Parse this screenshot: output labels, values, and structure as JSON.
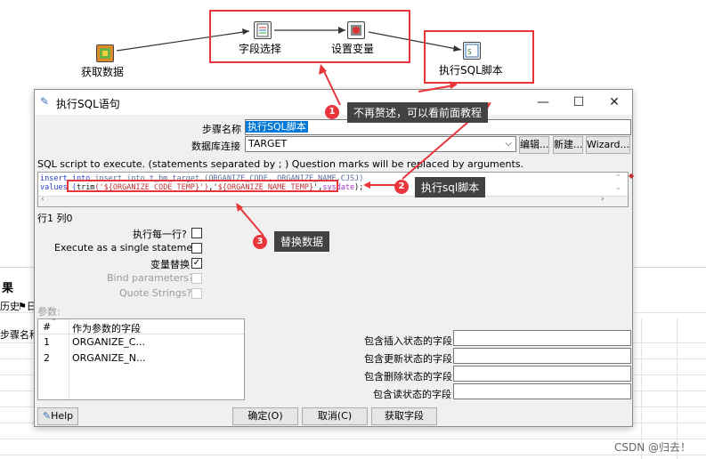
{
  "flow": {
    "nodes": [
      {
        "label": "获取数据"
      },
      {
        "label": "字段选择"
      },
      {
        "label": "设置变量"
      },
      {
        "label": "执行SQL脚本"
      }
    ]
  },
  "background": {
    "panel_title": "果",
    "tab1": "历史",
    "tab2": "日",
    "step_name_col": "步骤名称"
  },
  "dialog": {
    "title": "执行SQL语句",
    "step_name_label": "步骤名称",
    "step_name_value": "执行SQL脚本",
    "db_conn_label": "数据库连接",
    "db_conn_value": "TARGET",
    "edit_btn": "编辑...",
    "new_btn": "新建...",
    "wizard_btn": "Wizard...",
    "sql_hint": "SQL script to execute. (statements separated by ; ) Question marks will be replaced by arguments.",
    "sql_line1": "insert into t_bm_target (ORGANIZE_CODE, ORGANIZE_NAME,CJSJ)",
    "sql_line2_prefix": "values (",
    "sql_line2_trim1": "trim",
    "sql_line2_arg1": "('${ORGANIZE_CODE_TEMP}')",
    "sql_line2_sep": ",'",
    "sql_line2_arg2": "${ORGANIZE_NAME_TEMP}",
    "sql_line2_end": "',",
    "sql_line2_fn": "sysdate",
    "sql_line2_close": ");",
    "cursor_pos": "行1 列0",
    "exec_each_row": "执行每一行?",
    "exec_single": "Execute as a single statement",
    "var_replace": "变量替换",
    "bind_params": "Bind parameters?",
    "quote_strings": "Quote Strings?",
    "params_label": "参数:",
    "table_headers": [
      "#",
      "作为参数的字段"
    ],
    "table_rows": [
      [
        "1",
        "ORGANIZE_C..."
      ],
      [
        "2",
        "ORGANIZE_N..."
      ]
    ],
    "insert_status": "包含插入状态的字段",
    "update_status": "包含更新状态的字段",
    "delete_status": "包含删除状态的字段",
    "read_status": "包含读状态的字段",
    "help_btn": "Help",
    "ok_btn": "确定(O)",
    "cancel_btn": "取消(C)",
    "get_fields_btn": "获取字段"
  },
  "annotations": {
    "callout1_num": "1",
    "callout1": "不再赘述，可以看前面教程",
    "callout2_num": "2",
    "callout2": "执行sql脚本",
    "callout3_num": "3",
    "callout3": "替换数据"
  },
  "watermark": "CSDN @归去！",
  "colors": {
    "accent_red": "#e8353a",
    "selection_blue": "#0078d7",
    "callout_bg": "#424242"
  }
}
